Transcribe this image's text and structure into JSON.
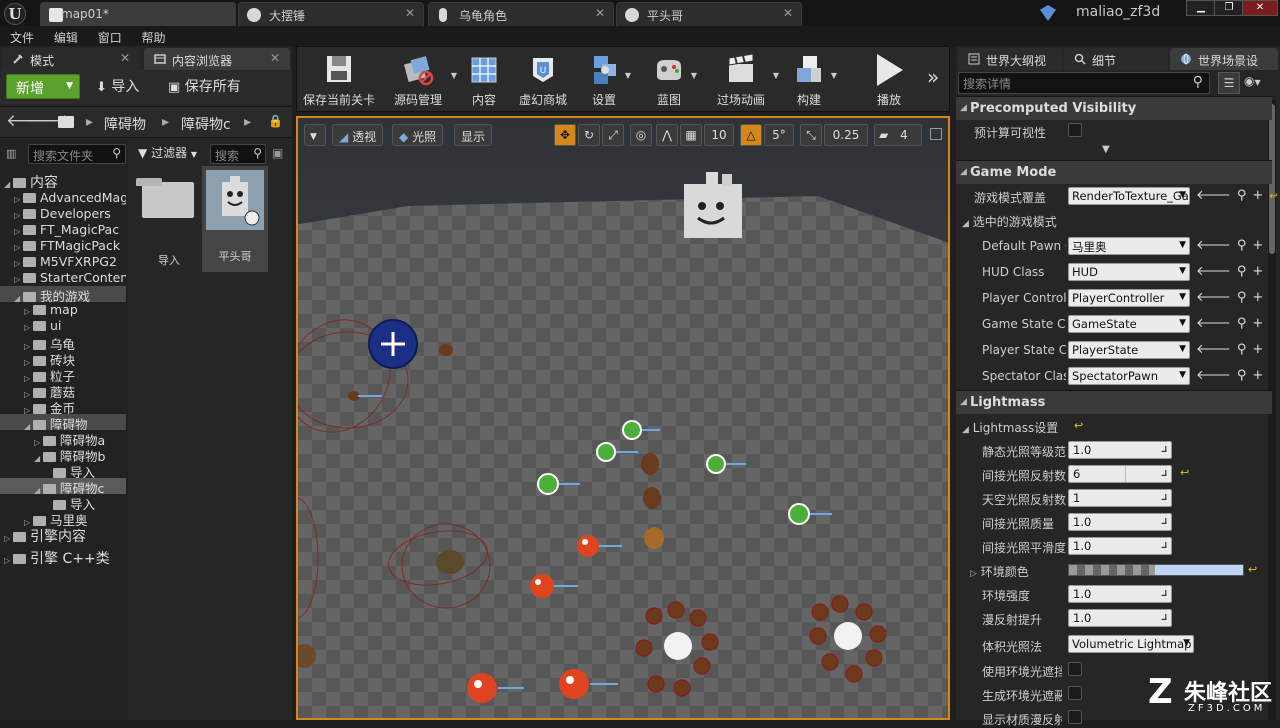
{
  "titlebar": {
    "logo": "U",
    "tabs": [
      {
        "label": "map01*",
        "icon": "level-icon"
      },
      {
        "label": "大摆锤",
        "icon": "blueprint-icon"
      },
      {
        "label": "乌龟角色",
        "icon": "character-icon"
      },
      {
        "label": "平头哥",
        "icon": "blueprint-icon"
      }
    ],
    "project_name": "maliao_zf3d"
  },
  "menu": [
    "文件",
    "编辑",
    "窗口",
    "帮助"
  ],
  "left_tabs": {
    "modes": "模式",
    "content_browser": "内容浏览器"
  },
  "content_browser": {
    "new_button": "新增",
    "import_button": "导入",
    "save_all_button": "保存所有",
    "path": [
      "障碍物",
      "障碍物c"
    ],
    "search_folders_placeholder": "搜索文件夹",
    "filters_label": "过滤器",
    "search_assets_placeholder": "搜索",
    "tree": [
      {
        "label": "内容",
        "level": 0,
        "expanded": true
      },
      {
        "label": "AdvancedMag",
        "level": 1
      },
      {
        "label": "Developers",
        "level": 1
      },
      {
        "label": "FT_MagicPac",
        "level": 1
      },
      {
        "label": "FTMagicPack",
        "level": 1
      },
      {
        "label": "M5VFXRPG2",
        "level": 1
      },
      {
        "label": "StarterConten",
        "level": 1
      },
      {
        "label": "我的游戏",
        "level": 1,
        "expanded": true
      },
      {
        "label": "map",
        "level": 2
      },
      {
        "label": "ui",
        "level": 2
      },
      {
        "label": "乌龟",
        "level": 2
      },
      {
        "label": "砖块",
        "level": 2
      },
      {
        "label": "粒子",
        "level": 2
      },
      {
        "label": "蘑菇",
        "level": 2
      },
      {
        "label": "金币",
        "level": 2
      },
      {
        "label": "障碍物",
        "level": 2,
        "expanded": true
      },
      {
        "label": "障碍物a",
        "level": 3
      },
      {
        "label": "障碍物b",
        "level": 3,
        "expanded": true
      },
      {
        "label": "导入",
        "level": 4
      },
      {
        "label": "障碍物c",
        "level": 3,
        "expanded": true,
        "selected": true
      },
      {
        "label": "导入",
        "level": 4
      },
      {
        "label": "马里奥",
        "level": 2
      },
      {
        "label": "引擎内容",
        "level": 0
      },
      {
        "label": "引擎 C++类",
        "level": 0
      }
    ],
    "assets": [
      {
        "label": "导入",
        "type": "folder"
      },
      {
        "label": "平头哥",
        "type": "blueprint"
      }
    ]
  },
  "toolbar": [
    {
      "label": "保存当前关卡",
      "icon": "save-icon"
    },
    {
      "label": "源码管理",
      "icon": "source-control-icon"
    },
    {
      "label": "内容",
      "icon": "content-icon"
    },
    {
      "label": "虚幻商城",
      "icon": "marketplace-icon"
    },
    {
      "label": "设置",
      "icon": "settings-icon"
    },
    {
      "label": "蓝图",
      "icon": "blueprints-icon"
    },
    {
      "label": "过场动画",
      "icon": "cinematics-icon"
    },
    {
      "label": "构建",
      "icon": "build-icon"
    },
    {
      "label": "播放",
      "icon": "play-icon"
    }
  ],
  "viewport": {
    "perspective": "透视",
    "lighting": "光照",
    "show": "显示",
    "grid_snap": "10",
    "rotation_snap": "5°",
    "scale_snap": "0.25",
    "camera_speed": "4"
  },
  "right_tabs": {
    "world_outliner": "世界大纲视",
    "details": "细节",
    "world_settings": "世界场景设"
  },
  "details": {
    "search_placeholder": "搜索详情",
    "precomputed_visibility": {
      "header": "Precomputed Visibility",
      "precompute_label": "预计算可视性"
    },
    "game_mode": {
      "header": "Game Mode",
      "override_label": "游戏模式覆盖",
      "override_value": "RenderToTexture_Ga",
      "selected_label": "选中的游戏模式",
      "rows": [
        {
          "label": "Default Pawn Cl",
          "value": "马里奥"
        },
        {
          "label": "HUD Class",
          "value": "HUD"
        },
        {
          "label": "Player Controlle",
          "value": "PlayerController"
        },
        {
          "label": "Game State Cla",
          "value": "GameState"
        },
        {
          "label": "Player State Cla",
          "value": "PlayerState"
        },
        {
          "label": "Spectator Class",
          "value": "SpectatorPawn"
        }
      ]
    },
    "lightmass": {
      "header": "Lightmass",
      "settings_label": "Lightmass设置",
      "rows": [
        {
          "label": "静态光照等级范围",
          "value": "1.0"
        },
        {
          "label": "间接光照反射数",
          "value": "6",
          "modified": true
        },
        {
          "label": "天空光照反射数",
          "value": "1"
        },
        {
          "label": "间接光照质量",
          "value": "1.0"
        },
        {
          "label": "间接光照平滑度",
          "value": "1.0"
        }
      ],
      "env_color_label": "环境颜色",
      "env_color": "#c0d4f8",
      "rows2": [
        {
          "label": "环境强度",
          "value": "1.0"
        },
        {
          "label": "漫反射提升",
          "value": "1.0"
        }
      ],
      "volume_label": "体积光照法",
      "volume_value": "Volumetric Lightmap",
      "check_rows": [
        "使用环境光遮挡",
        "生成环境光遮蔽材质",
        "显示材质漫反射"
      ]
    }
  },
  "watermark": {
    "logo": "Z",
    "text": "朱峰社区",
    "url": "ZF3D.COM"
  },
  "colors": {
    "accent": "#d4881a",
    "new_button": "#5aa22b",
    "reset": "#e0c030"
  }
}
